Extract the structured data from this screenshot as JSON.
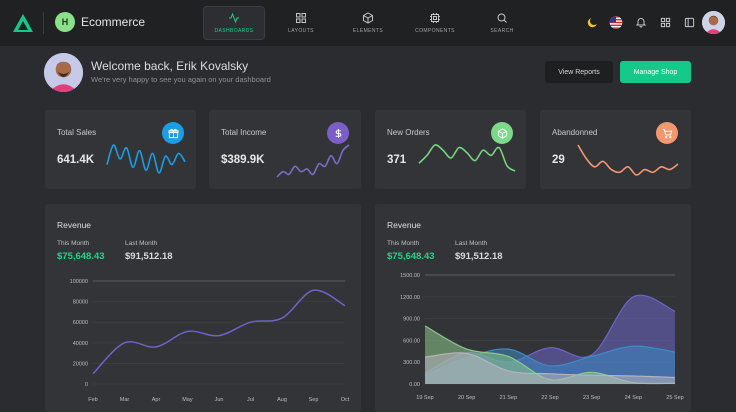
{
  "brand": {
    "initial": "H",
    "name": "Ecommerce"
  },
  "nav": [
    {
      "label": "DASHBOARDS",
      "icon": "activity-icon",
      "active": true
    },
    {
      "label": "LAYOUTS",
      "icon": "grid-icon",
      "active": false
    },
    {
      "label": "ELEMENTS",
      "icon": "box-icon",
      "active": false
    },
    {
      "label": "COMPONENTS",
      "icon": "cpu-icon",
      "active": false
    },
    {
      "label": "SEARCH",
      "icon": "search-icon",
      "active": false
    }
  ],
  "welcome": {
    "title": "Welcome back, Erik Kovalsky",
    "subtitle": "We're very happy to see you again on your dashboard",
    "view_reports": "View Reports",
    "manage_shop": "Manage Shop"
  },
  "stats": [
    {
      "label": "Total Sales",
      "value": "641.4K",
      "icon": "gift-icon",
      "color": "#1b9ee8",
      "spark": [
        5,
        12,
        7,
        11,
        4,
        10,
        3,
        9,
        2,
        8,
        5,
        9,
        6
      ],
      "line": "#1b9ee8"
    },
    {
      "label": "Total Income",
      "value": "$389.9K",
      "icon": "dollar-icon",
      "color": "#7b5fc4",
      "spark": [
        1,
        3,
        2,
        5,
        3,
        4,
        2,
        6,
        5,
        9,
        6,
        11,
        13
      ],
      "line": "#7b6cc9"
    },
    {
      "label": "New Orders",
      "value": "371",
      "icon": "box-icon",
      "color": "#7bd98a",
      "spark": [
        6,
        9,
        13,
        11,
        8,
        12,
        10,
        7,
        11,
        9,
        12,
        5,
        3
      ],
      "line": "#79d37f"
    },
    {
      "label": "Abandonned",
      "value": "29",
      "icon": "cart-icon",
      "color": "#f2976e",
      "spark": [
        14,
        9,
        6,
        8,
        5,
        4,
        6,
        3,
        5,
        4,
        6,
        5,
        7
      ],
      "line": "#f2976e"
    }
  ],
  "revenue_left": {
    "title": "Revenue",
    "this_month_label": "This Month",
    "this_month": "$75,648.43",
    "last_month_label": "Last Month",
    "last_month": "$91,512.18"
  },
  "revenue_right": {
    "title": "Revenue",
    "this_month_label": "This Month",
    "this_month": "$75,648.43",
    "last_month_label": "Last Month",
    "last_month": "$91,512.18"
  },
  "colors": {
    "accent": "#14c989",
    "positive": "#1fd58a"
  },
  "chart_data": [
    {
      "type": "line",
      "categories": [
        "Feb",
        "Mar",
        "Apr",
        "May",
        "Jun",
        "Jul",
        "Aug",
        "Sep",
        "Oct"
      ],
      "yticks": [
        "0",
        "20000",
        "40000",
        "60000",
        "80000",
        "100000"
      ],
      "ylim": [
        0,
        100000
      ],
      "series": [
        {
          "color": "#6b63c8",
          "values": [
            10000,
            40000,
            36000,
            51000,
            47000,
            60000,
            64000,
            91000,
            76000
          ]
        }
      ]
    },
    {
      "type": "area",
      "categories": [
        "19 Sep",
        "20 Sep",
        "21 Sep",
        "22 Sep",
        "23 Sep",
        "24 Sep",
        "25 Sep"
      ],
      "yticks": [
        "0.00",
        "300.00",
        "600.00",
        "900.00",
        "1200.00",
        "1500.00"
      ],
      "ylim": [
        0,
        1500
      ],
      "series": [
        {
          "color": "#6a66c7",
          "values": [
            150,
            430,
            300,
            500,
            400,
            1200,
            1000
          ]
        },
        {
          "color": "#3c8bc7",
          "values": [
            120,
            360,
            480,
            250,
            380,
            520,
            440
          ]
        },
        {
          "color": "#8bc98a",
          "values": [
            800,
            480,
            380,
            60,
            160,
            20,
            10
          ]
        },
        {
          "color": "#b7b2bd",
          "values": [
            370,
            420,
            180,
            140,
            120,
            110,
            90
          ]
        }
      ]
    }
  ]
}
